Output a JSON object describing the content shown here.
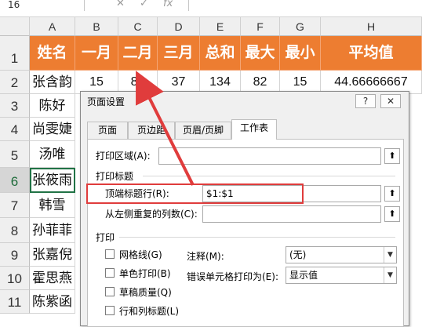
{
  "formula_bar": {
    "name_box": "16",
    "fx_icon": "fx-icon",
    "cancel_icon": "close-icon",
    "enter_icon": "check-icon",
    "accent": "#ed7d31"
  },
  "columns": [
    "A",
    "B",
    "C",
    "D",
    "E",
    "F",
    "G",
    "H"
  ],
  "rows": [
    "1",
    "2",
    "3",
    "4",
    "5",
    "6",
    "7",
    "8",
    "9",
    "10",
    "11"
  ],
  "header_row": [
    "姓名",
    "一月",
    "二月",
    "三月",
    "总和",
    "最大",
    "最小",
    "平均值"
  ],
  "row2": [
    "张含韵",
    "15",
    "82",
    "37",
    "134",
    "82",
    "15",
    "44.66666667"
  ],
  "names": [
    "陈好",
    "尚雯婕",
    "汤唯",
    "张筱雨",
    "韩雪",
    "孙菲菲",
    "张嘉倪",
    "霍思燕",
    "陈紫函"
  ],
  "dialog": {
    "title": "页面设置",
    "help": "?",
    "close": "✕",
    "tabs": [
      "页面",
      "页边距",
      "页眉/页脚",
      "工作表"
    ],
    "print_area_label": "打印区域(A):",
    "print_area_value": "",
    "print_titles_label": "打印标题",
    "rows_repeat_label": "顶端标题行(R):",
    "rows_repeat_value": "$1:$1",
    "cols_repeat_label": "从左侧重复的列数(C):",
    "cols_repeat_value": "",
    "print_section_label": "打印",
    "gridlines": "网格线(G)",
    "mono": "单色打印(B)",
    "draft": "草稿质量(Q)",
    "row_col_headings": "行和列标题(L)",
    "comments_label": "注释(M):",
    "comments_value": "(无)",
    "errors_label": "错误单元格打印为(E):",
    "errors_value": "显示值",
    "picker_icon": "collapse-dialog-icon",
    "highlight_color": "#e03c3c"
  }
}
